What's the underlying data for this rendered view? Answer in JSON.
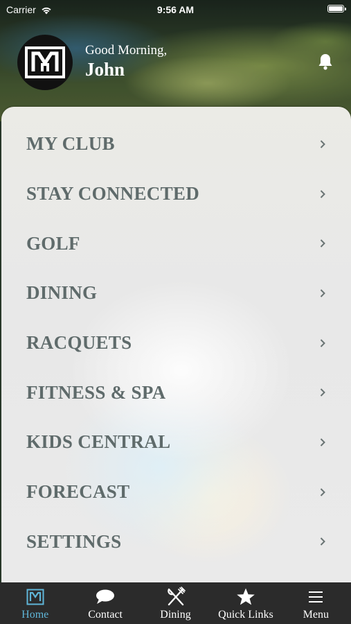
{
  "status_bar": {
    "carrier": "Carrier",
    "time": "9:56 AM"
  },
  "header": {
    "greeting": "Good Morning,",
    "user_name": "John"
  },
  "menu": {
    "items": [
      {
        "label": "MY CLUB"
      },
      {
        "label": "STAY CONNECTED"
      },
      {
        "label": "GOLF"
      },
      {
        "label": "DINING"
      },
      {
        "label": "RACQUETS"
      },
      {
        "label": "FITNESS & SPA"
      },
      {
        "label": "KIDS CENTRAL"
      },
      {
        "label": "FORECAST"
      },
      {
        "label": "SETTINGS"
      }
    ]
  },
  "tab_bar": {
    "tabs": [
      {
        "label": "Home",
        "icon": "club-logo-icon",
        "active": true
      },
      {
        "label": "Contact",
        "icon": "chat-bubble-icon",
        "active": false
      },
      {
        "label": "Dining",
        "icon": "fork-knife-icon",
        "active": false
      },
      {
        "label": "Quick Links",
        "icon": "star-icon",
        "active": false
      },
      {
        "label": "Menu",
        "icon": "hamburger-icon",
        "active": false
      }
    ]
  },
  "colors": {
    "accent": "#5fb6d8",
    "menu_text": "#5f6b6b",
    "tab_bar_bg": "#2b2b2b",
    "logo_bg": "#111111"
  }
}
